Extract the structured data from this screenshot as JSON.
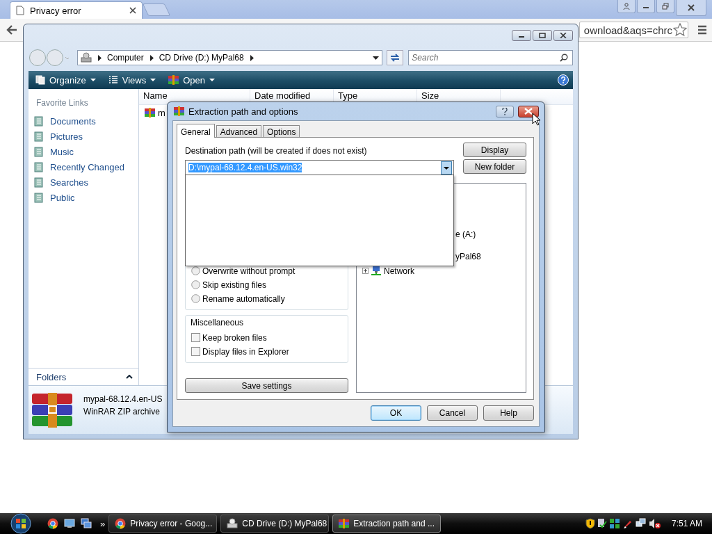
{
  "browser": {
    "tab": {
      "title": "Privacy error"
    },
    "omnibox": {
      "value": "ownload&aqs=chrc"
    }
  },
  "explorer": {
    "breadcrumb": [
      "Computer",
      "CD Drive (D:) MyPal68"
    ],
    "search": {
      "placeholder": "Search"
    },
    "toolbar": [
      {
        "label": "Organize"
      },
      {
        "label": "Views"
      },
      {
        "label": "Open"
      }
    ],
    "sidebar": {
      "title": "Favorite Links",
      "items": [
        "Documents",
        "Pictures",
        "Music",
        "Recently Changed",
        "Searches",
        "Public"
      ],
      "folders": "Folders"
    },
    "columns": [
      "Name",
      "Date modified",
      "Type",
      "Size"
    ],
    "files": [
      {
        "name": "m"
      }
    ],
    "details": {
      "name": "mypal-68.12.4.en-US",
      "type": "WinRAR ZIP archive"
    }
  },
  "dialog": {
    "title": "Extraction path and options",
    "tabs": [
      {
        "label": "General",
        "selected": true
      },
      {
        "label": "Advanced",
        "selected": false
      },
      {
        "label": "Options",
        "selected": false
      }
    ],
    "destination_label": "Destination path (will be created if does not exist)",
    "destination": {
      "value": "D:\\mypal-68.12.4.en-US.win32",
      "highlighted": true
    },
    "side_buttons": [
      "Display",
      "New folder"
    ],
    "tree": [
      {
        "label": "e (A:)",
        "kind": "partial"
      },
      {
        "label": "yPal68",
        "kind": "partial"
      },
      {
        "label": "Network",
        "kind": "node",
        "expanded": false
      }
    ],
    "overwrite": [
      {
        "label": "Overwrite without prompt",
        "selected": false
      },
      {
        "label": "Skip existing files",
        "selected": false
      },
      {
        "label": "Rename automatically",
        "selected": false
      }
    ],
    "misc": {
      "title": "Miscellaneous",
      "options": [
        {
          "label": "Keep broken files",
          "checked": false
        },
        {
          "label": "Display files in Explorer",
          "checked": false
        }
      ]
    },
    "save": "Save settings",
    "buttons": [
      {
        "label": "OK",
        "default": true
      },
      {
        "label": "Cancel",
        "default": false
      },
      {
        "label": "Help",
        "default": false
      }
    ]
  },
  "taskbar": {
    "overflow": "»",
    "tasks": [
      {
        "label": "Privacy error - Goog...",
        "active": false
      },
      {
        "label": "CD Drive (D:) MyPal68",
        "active": false
      },
      {
        "label": "Extraction path and ...",
        "active": true
      }
    ],
    "clock": "7:51 AM"
  }
}
